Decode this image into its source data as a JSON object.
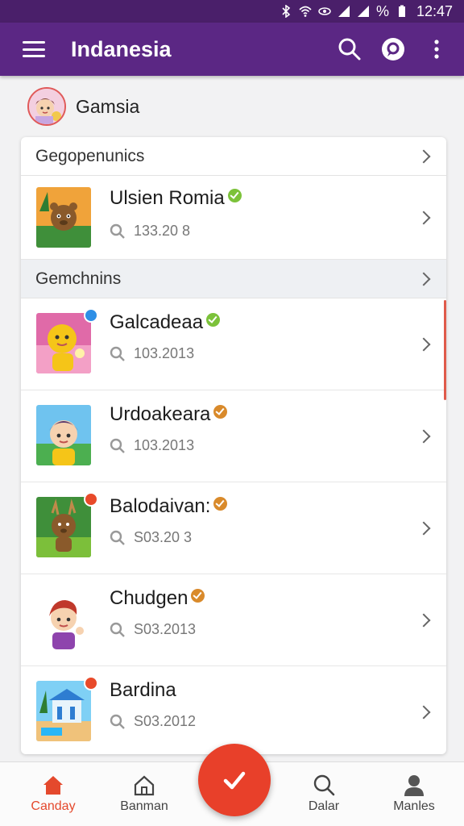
{
  "status_bar": {
    "time": "12:47",
    "percent_symbol": "%"
  },
  "app_bar": {
    "title": "Indanesia"
  },
  "profile": {
    "name": "Gamsia"
  },
  "sections": [
    {
      "header": "Gegopenunics"
    },
    {
      "header": "Gemchnins"
    }
  ],
  "top_item": {
    "name": "Ulsien Romia",
    "meta": "133.20 8",
    "verified_color": "#7cc23a"
  },
  "items": [
    {
      "name": "Galcadeaa",
      "meta": "103.2013",
      "verified_color": "#7cc23a",
      "badge_color": "#2e8fe6"
    },
    {
      "name": "Urdoakeara",
      "meta": "103.2013",
      "verified_color": "#d98a2b",
      "badge_color": ""
    },
    {
      "name": "Balodaivan:",
      "meta": "S03.20 3",
      "verified_color": "#d98a2b",
      "badge_color": "#e84a2a"
    },
    {
      "name": "Chudgen",
      "meta": "S03.2013",
      "verified_color": "#d98a2b",
      "badge_color": ""
    },
    {
      "name": "Bardina",
      "meta": "S03.2012",
      "verified_color": "",
      "badge_color": "#e84a2a"
    }
  ],
  "bottom_nav": [
    {
      "label": "Canday",
      "icon": "home-icon",
      "active": true
    },
    {
      "label": "Banman",
      "icon": "house-outline-icon",
      "active": false
    },
    {
      "label": "Dalar",
      "icon": "search-icon",
      "active": false
    },
    {
      "label": "Manles",
      "icon": "person-icon",
      "active": false
    }
  ],
  "colors": {
    "app_bar": "#5b2784",
    "accent": "#e8402a"
  }
}
